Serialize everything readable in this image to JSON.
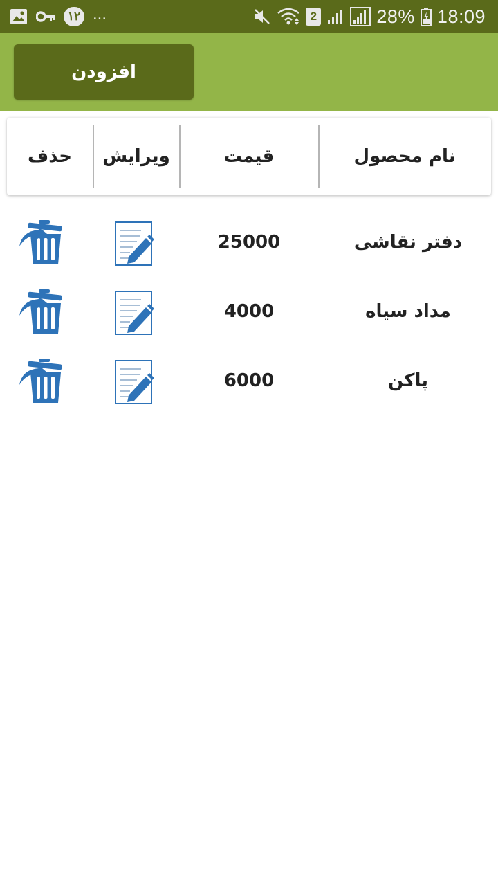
{
  "status_bar": {
    "left_icons": [
      "image-icon",
      "key-icon"
    ],
    "badge_text": "۱۲",
    "overflow": "...",
    "sim_badge": "2",
    "battery_percent": "28%",
    "time": "18:09"
  },
  "toolbar": {
    "add_label": "افزودن"
  },
  "table": {
    "headers": {
      "name": "نام محصول",
      "price": "قیمت",
      "edit": "ویرایش",
      "delete": "حذف"
    },
    "rows": [
      {
        "name": "دفتر نقاشی",
        "price": "25000"
      },
      {
        "name": "مداد سیاه",
        "price": "4000"
      },
      {
        "name": "پاکن",
        "price": "6000"
      }
    ]
  },
  "colors": {
    "status_bar": "#5a6a1a",
    "toolbar": "#93b548",
    "button": "#5a6a1a",
    "icon_blue": "#2e73b8"
  }
}
